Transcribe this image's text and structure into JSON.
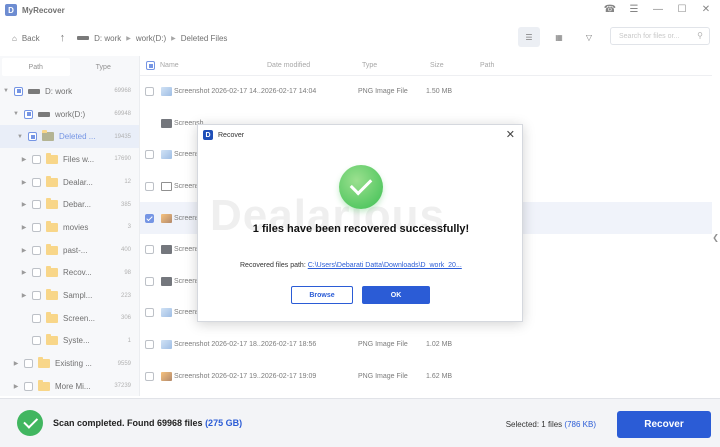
{
  "app": {
    "title": "MyRecover",
    "logo_letter": "D"
  },
  "toolbar": {
    "back_label": "Back",
    "breadcrumb": [
      "D: work",
      "work(D:)",
      "Deleted Files"
    ],
    "search_placeholder": "Search for files or..."
  },
  "left_panel": {
    "tabs": [
      "Path",
      "Type"
    ],
    "tree": [
      {
        "label": "D: work",
        "count": "69968"
      },
      {
        "label": "work(D:)",
        "count": "69948"
      },
      {
        "label": "Deleted ...",
        "count": "19435"
      },
      {
        "label": "Files w...",
        "count": "17690"
      },
      {
        "label": "Dealar...",
        "count": "12"
      },
      {
        "label": "Debar...",
        "count": "385"
      },
      {
        "label": "movies",
        "count": "3"
      },
      {
        "label": "past-...",
        "count": "400"
      },
      {
        "label": "Recov...",
        "count": "98"
      },
      {
        "label": "Sampl...",
        "count": "223"
      },
      {
        "label": "Screen...",
        "count": "306"
      },
      {
        "label": "Syste...",
        "count": "1"
      },
      {
        "label": "Existing ...",
        "count": "9559"
      },
      {
        "label": "More Mi...",
        "count": "37239"
      }
    ]
  },
  "file_list": {
    "headers": [
      "Name",
      "Date modified",
      "Type",
      "Size",
      "Path"
    ],
    "rows": [
      {
        "name": "Screenshot 2026-02-17 14...",
        "date": "2026-02-17 14:04",
        "type": "PNG Image File",
        "size": "1.50 MB"
      },
      {
        "name": "Screensh",
        "date": "",
        "type": "",
        "size": ""
      },
      {
        "name": "Screensh",
        "date": "",
        "type": "",
        "size": ""
      },
      {
        "name": "Screensh",
        "date": "",
        "type": "",
        "size": ""
      },
      {
        "name": "Screensh",
        "date": "",
        "type": "",
        "size": ""
      },
      {
        "name": "Screensh",
        "date": "",
        "type": "",
        "size": ""
      },
      {
        "name": "Screensh",
        "date": "",
        "type": "",
        "size": ""
      },
      {
        "name": "Screensh",
        "date": "",
        "type": "",
        "size": ""
      },
      {
        "name": "Screenshot 2026-02-17 18...",
        "date": "2026-02-17 18:56",
        "type": "PNG Image File",
        "size": "1.02 MB"
      },
      {
        "name": "Screenshot 2026-02-17 19...",
        "date": "2026-02-17 19:09",
        "type": "PNG Image File",
        "size": "1.62 MB"
      }
    ]
  },
  "bottom_bar": {
    "scan_text": "Scan completed. Found 69968 files",
    "scan_size": "(275 GB)",
    "selected_text": "Selected: 1 files",
    "selected_size": "(786 KB)",
    "recover_label": "Recover"
  },
  "dialog": {
    "title": "Recover",
    "message": "1 files have been recovered successfully!",
    "path_label": "Recovered files path:",
    "path_value": "C:\\Users\\Debarati Datta\\Downloads\\D_work_20...",
    "browse_label": "Browse",
    "ok_label": "OK",
    "watermark": "Dealarious"
  },
  "colors": {
    "accent": "#2b5cd6",
    "success": "#41b660"
  }
}
